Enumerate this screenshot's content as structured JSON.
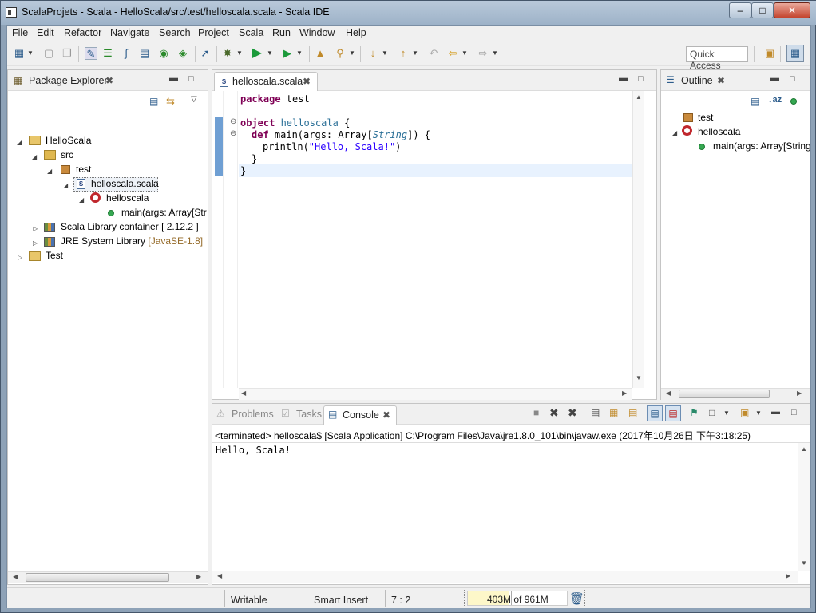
{
  "window": {
    "title": "ScalaProjets - Scala - HelloScala/src/test/helloscala.scala - Scala IDE"
  },
  "menu": [
    "File",
    "Edit",
    "Refactor",
    "Navigate",
    "Search",
    "Project",
    "Scala",
    "Run",
    "Window",
    "Help"
  ],
  "toolbar": {
    "quick_access": "Quick Access"
  },
  "package_explorer": {
    "title": "Package Explorer",
    "items": [
      {
        "label": "HelloScala"
      },
      {
        "label": "src"
      },
      {
        "label": "test"
      },
      {
        "label": "helloscala.scala"
      },
      {
        "label": "helloscala"
      },
      {
        "label": "main(args: Array[Str"
      },
      {
        "label": "Scala Library container [ 2.12.2 ]"
      },
      {
        "label": "JRE System Library",
        "extra": "[JavaSE-1.8]"
      },
      {
        "label": "Test"
      }
    ]
  },
  "editor": {
    "tab": "helloscala.scala",
    "lines": {
      "l1_kw": "package",
      "l1_rest": " test",
      "l2_kw": "object",
      "l2_name": " helloscala",
      "l2_rest": " {",
      "l3_kw": "def",
      "l3_a": " main(args: Array[",
      "l3_type": "String",
      "l3_b": "]) {",
      "l4_a": "println(",
      "l4_str": "\"Hello, Scala!\"",
      "l4_b": ")",
      "l5": "}",
      "l6": "}"
    }
  },
  "outline": {
    "title": "Outline",
    "items": [
      {
        "label": "test"
      },
      {
        "label": "helloscala"
      },
      {
        "label": "main(args: Array[String"
      }
    ]
  },
  "console": {
    "tabs": [
      "Problems",
      "Tasks",
      "Console"
    ],
    "header": "<terminated> helloscala$ [Scala Application] C:\\Program Files\\Java\\jre1.8.0_101\\bin\\javaw.exe (2017年10月26日 下午3:18:25)",
    "output": "Hello, Scala!"
  },
  "status": {
    "writable": "Writable",
    "insert_mode": "Smart Insert",
    "position": "7 : 2",
    "heap": "403M of 961M",
    "heap_used_fraction": 0.42
  },
  "colors": {
    "keyword": "#7f0055",
    "string": "#2a00ff",
    "type": "#2a6f97"
  }
}
